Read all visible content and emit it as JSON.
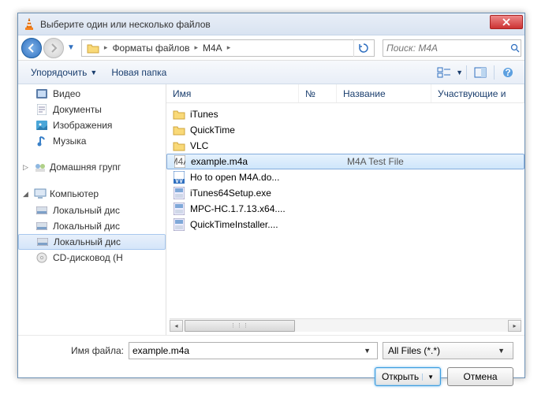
{
  "titlebar": {
    "text": "Выберите один или несколько файлов"
  },
  "breadcrumb": {
    "seg1": "Форматы файлов",
    "seg2": "M4A"
  },
  "search": {
    "placeholder": "Поиск: M4A"
  },
  "toolbar": {
    "organize": "Упорядочить",
    "new_folder": "Новая папка"
  },
  "columns": {
    "name": "Имя",
    "num": "№",
    "title": "Название",
    "part": "Участвующие и"
  },
  "sidebar": {
    "items": [
      {
        "label": "Видео"
      },
      {
        "label": "Документы"
      },
      {
        "label": "Изображения"
      },
      {
        "label": "Музыка"
      }
    ],
    "homegroup": "Домашняя групг",
    "computer": "Компьютер",
    "drives": [
      {
        "label": "Локальный дис"
      },
      {
        "label": "Локальный дис"
      },
      {
        "label": "Локальный дис"
      },
      {
        "label": "CD-дисковод (Н"
      }
    ]
  },
  "files": [
    {
      "name": "iTunes",
      "type": "folder",
      "title": ""
    },
    {
      "name": "QuickTime",
      "type": "folder",
      "title": ""
    },
    {
      "name": "VLC",
      "type": "folder",
      "title": ""
    },
    {
      "name": "example.m4a",
      "type": "m4a",
      "title": "M4A Test File",
      "selected": true
    },
    {
      "name": "Ho to open M4A.do...",
      "type": "doc",
      "title": ""
    },
    {
      "name": "iTunes64Setup.exe",
      "type": "exe",
      "title": ""
    },
    {
      "name": "MPC-HC.1.7.13.x64....",
      "type": "exe",
      "title": ""
    },
    {
      "name": "QuickTimeInstaller....",
      "type": "exe",
      "title": ""
    }
  ],
  "filename": {
    "label": "Имя файла:",
    "value": "example.m4a"
  },
  "filter": {
    "label": "All Files (*.*)"
  },
  "buttons": {
    "open": "Открыть",
    "cancel": "Отмена"
  }
}
